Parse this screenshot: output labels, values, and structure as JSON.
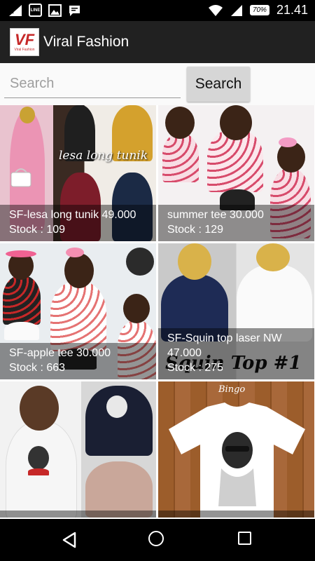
{
  "status": {
    "time": "21.41",
    "battery": "70%",
    "notification_icons": [
      "signal-x-icon",
      "line-app-icon",
      "image-icon",
      "chat-icon"
    ]
  },
  "appbar": {
    "logo_text": "VF",
    "logo_subtext": "Viral Fashion",
    "title": "Viral Fashion"
  },
  "search": {
    "placeholder": "Search",
    "value": "",
    "button_label": "Search"
  },
  "products": [
    {
      "name": "SF-lesa long tunik 49.000",
      "stock": "Stock : 109",
      "tag": "lesa long tunik"
    },
    {
      "name": "summer tee 30.000",
      "stock": "Stock : 129",
      "tag": ""
    },
    {
      "name": "SF-apple tee 30.000",
      "stock": "Stock : 663",
      "tag": ""
    },
    {
      "name": "SF-Squin top laser NW 47.000",
      "stock": "Stock : 275",
      "tag": "Squin Top #1"
    },
    {
      "name": "",
      "stock": "",
      "tag": ""
    },
    {
      "name": "",
      "stock": "",
      "tag": "Bingo"
    }
  ],
  "colors": {
    "statusbar": "#000000",
    "appbar": "#212121",
    "search_bg": "#fafafa",
    "button": "#d6d6d6"
  }
}
